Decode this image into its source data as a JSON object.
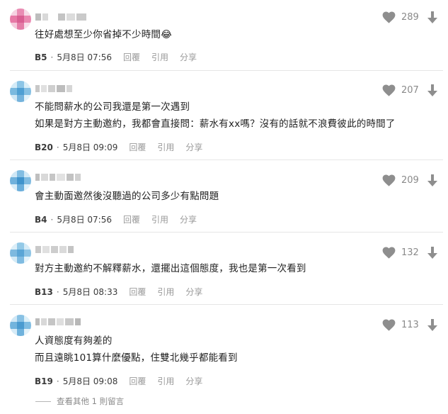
{
  "colors": {
    "pink": "#e87aa8",
    "blue": "#57a8d8",
    "gray": "#cfcfcf"
  },
  "icons": {
    "like": "heart-icon",
    "dislike": "down-arrow-icon"
  },
  "actions": {
    "reply": "回覆",
    "quote": "引用",
    "share": "分享"
  },
  "comments": [
    {
      "floor": "B5",
      "date": "5月8日 07:56",
      "likes": "289",
      "lines": [
        "往好處想至少你省掉不少時間😂"
      ]
    },
    {
      "floor": "B20",
      "date": "5月8日 09:09",
      "likes": "207",
      "lines": [
        "不能問薪水的公司我還是第一次遇到",
        "如果是對方主動邀約，我都會直接問：薪水有xx嗎？沒有的話就不浪費彼此的時間了"
      ]
    },
    {
      "floor": "B4",
      "date": "5月8日 07:56",
      "likes": "209",
      "lines": [
        "會主動面邀然後沒聽過的公司多少有點問題"
      ]
    },
    {
      "floor": "B13",
      "date": "5月8日 08:33",
      "likes": "132",
      "lines": [
        "對方主動邀約不解釋薪水，還擺出這個態度，我也是第一次看到"
      ]
    },
    {
      "floor": "B19",
      "date": "5月8日 09:08",
      "likes": "113",
      "lines": [
        "人資態度有夠差的",
        "而且遠眺101算什麼優點，住雙北幾乎都能看到"
      ]
    }
  ],
  "view_more": "查看其他 1 則留言"
}
